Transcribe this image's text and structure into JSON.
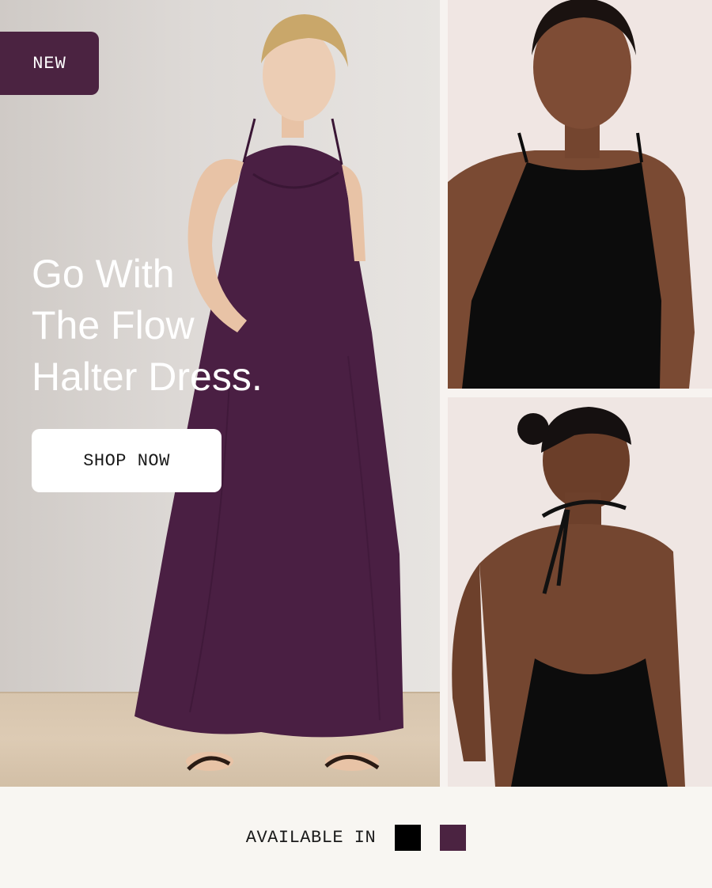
{
  "hero": {
    "badge": "NEW",
    "headline": [
      "Go With",
      "The Flow",
      "Halter Dress."
    ],
    "cta": "SHOP NOW"
  },
  "images": {
    "main": "model-in-purple-halter-maxi-dress",
    "top_right": "model-in-black-halter-dress-front",
    "bottom_right": "model-in-black-halter-dress-back"
  },
  "footer": {
    "label": "AVAILABLE IN",
    "swatches": [
      {
        "name": "black",
        "color": "#000000"
      },
      {
        "name": "plum",
        "color": "#4b2341"
      }
    ]
  },
  "colors": {
    "accent": "#4b2341",
    "dress_purple": "#4a1f43",
    "dress_black": "#0c0c0c"
  }
}
